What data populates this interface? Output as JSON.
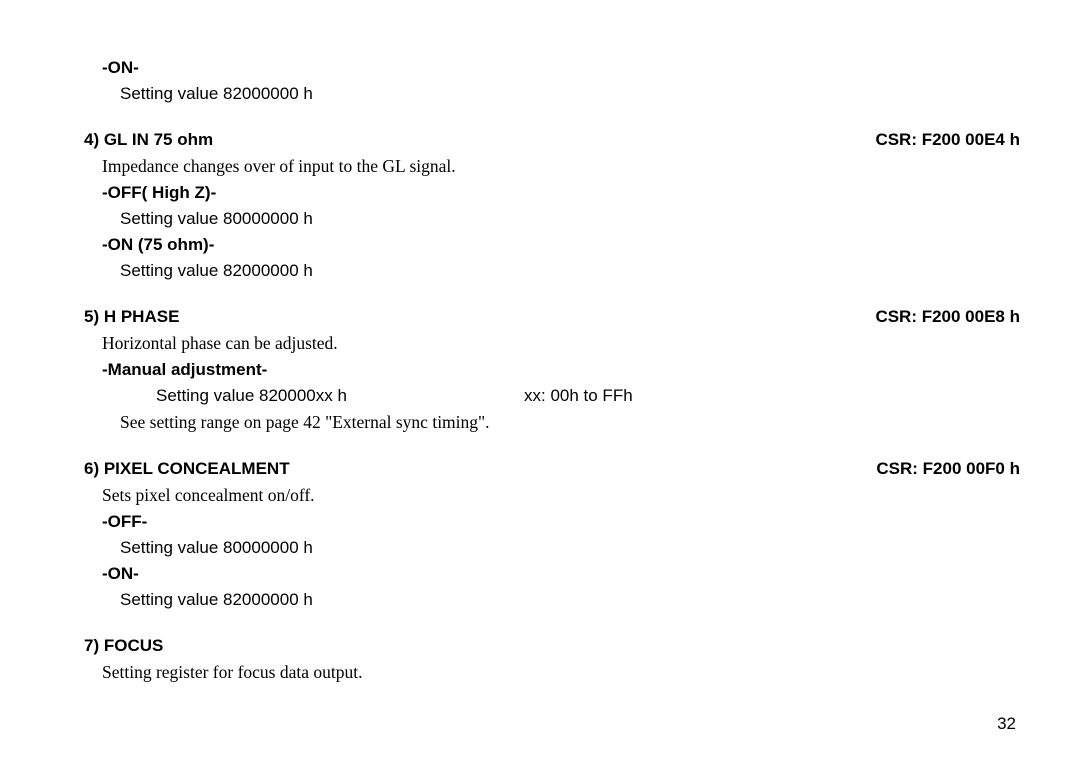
{
  "s3": {
    "on_label": "-ON-",
    "on_value": "Setting value 82000000 h"
  },
  "s4": {
    "title_left": "4) GL IN 75 ohm",
    "title_right": "CSR: F200 00E4 h",
    "desc": "Impedance changes over of input to the GL signal.",
    "off_label": "-OFF( High Z)-",
    "off_value": "Setting value 80000000 h",
    "on_label": "-ON (75 ohm)-",
    "on_value": "Setting value 82000000 h"
  },
  "s5": {
    "title_left": "5) H PHASE",
    "title_right": "CSR: F200 00E8 h",
    "desc": "Horizontal phase can be adjusted.",
    "manual_label": "-Manual adjustment-",
    "manual_value_left": "Setting value 820000xx h",
    "manual_value_right": "xx: 00h to FFh",
    "note": "See setting range on page 42 \"External sync timing\"."
  },
  "s6": {
    "title_left": "6) PIXEL CONCEALMENT",
    "title_right": "CSR: F200 00F0 h",
    "desc": "Sets pixel concealment on/off.",
    "off_label": "-OFF-",
    "off_value": "Setting value 80000000 h",
    "on_label": "-ON-",
    "on_value": "Setting value 82000000 h"
  },
  "s7": {
    "title_left": "7) FOCUS",
    "desc": "Setting register for focus data output."
  },
  "page_number": "32"
}
